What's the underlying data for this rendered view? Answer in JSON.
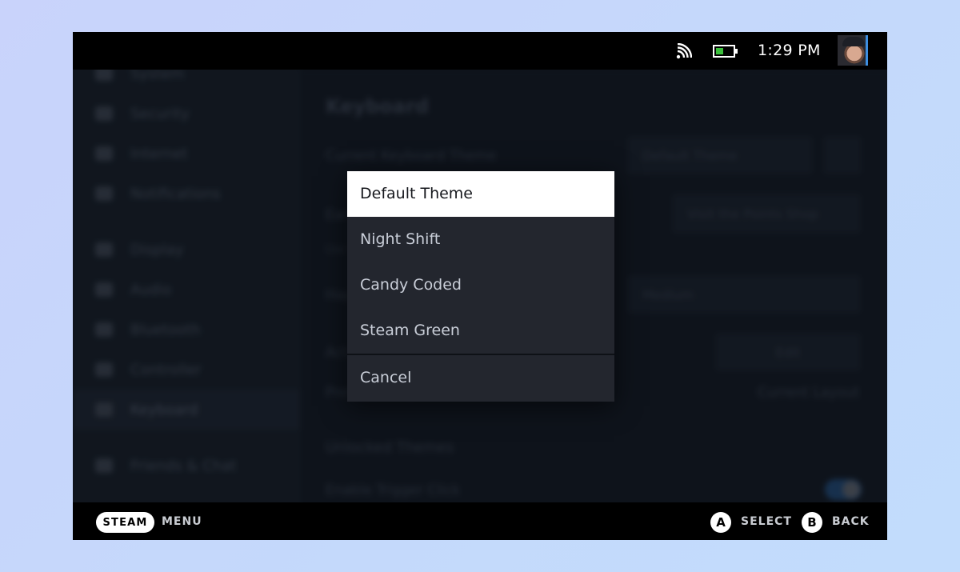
{
  "status_bar": {
    "wifi_icon": "wifi-icon",
    "battery_icon": "battery-icon",
    "battery_color": "#3bbf3b",
    "time": "1:29 PM",
    "avatar": "user-avatar"
  },
  "sidebar": {
    "items": [
      {
        "label": "System",
        "icon": "system-icon"
      },
      {
        "label": "Security",
        "icon": "lock-icon"
      },
      {
        "label": "Internet",
        "icon": "wifi-icon"
      },
      {
        "label": "Notifications",
        "icon": "bell-icon"
      },
      {
        "label": "Display",
        "icon": "display-icon"
      },
      {
        "label": "Audio",
        "icon": "speaker-icon"
      },
      {
        "label": "Bluetooth",
        "icon": "bluetooth-icon"
      },
      {
        "label": "Controller",
        "icon": "controller-icon"
      },
      {
        "label": "Keyboard",
        "icon": "keyboard-icon",
        "active": true
      },
      {
        "label": "Friends & Chat",
        "icon": "friends-icon"
      }
    ]
  },
  "page": {
    "title": "Keyboard",
    "current_theme_label": "Current Keyboard Theme",
    "current_theme_value": "Default Theme",
    "points_shop_label": "Earn more themes",
    "points_shop_button": "Visit the Points Shop",
    "points_shop_desc": "Use Steam Points to customize your Steam Deck",
    "haptic_label": "Haptic Feedback",
    "haptic_value": "Medium",
    "active_layouts_label": "Active Keyboard Layouts",
    "active_layouts_button": "Edit",
    "preferred_layout_label": "Preferred Layout",
    "preferred_layout_value": "Current Layout",
    "unlocked_themes_heading": "Unlocked Themes",
    "trigger_click_label": "Enable Trigger Click",
    "trigger_click_on": true
  },
  "dropdown": {
    "options": [
      {
        "label": "Default Theme",
        "selected": true
      },
      {
        "label": "Night Shift",
        "selected": false
      },
      {
        "label": "Candy Coded",
        "selected": false
      },
      {
        "label": "Steam Green",
        "selected": false
      }
    ],
    "cancel_label": "Cancel"
  },
  "bottom_bar": {
    "steam_label": "STEAM",
    "menu_label": "MENU",
    "a_button": "A",
    "select_label": "SELECT",
    "b_button": "B",
    "back_label": "BACK"
  }
}
